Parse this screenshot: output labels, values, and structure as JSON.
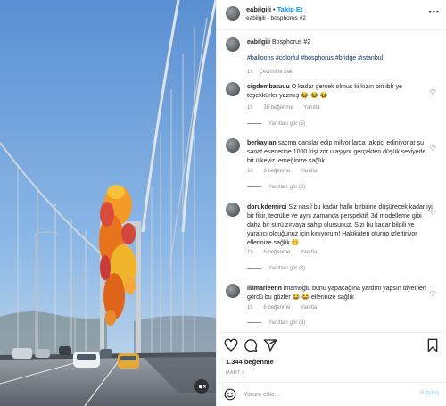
{
  "header": {
    "username": "eabilgili",
    "separator": "•",
    "follow_label": "Takip Et",
    "location": "eabilgili - bosphorus #2",
    "more_label": "•••"
  },
  "caption": {
    "username": "eabilgili",
    "text": "Bosphorus #2",
    "hashtags": "#balloons #colorful #bosphorus #bridge #istanbul",
    "time": "1h",
    "translate_label": "Çevirisine bak"
  },
  "comments": [
    {
      "username": "cigdembatuuu",
      "text": "O kadar gerçek olmuş ki kızın biri ibb ye teşekkürler yazmış 😂 😂 😂",
      "time": "1h",
      "likes": "35 beğenme",
      "reply_label": "Yanıtla",
      "replies": "Yanıtları gör (5)"
    },
    {
      "username": "berkaylan",
      "text": "saçma danslar edip milyonlarca takipçi ediniyorlar şu sanat eserlerine 1000 kişi zor ulaşıyor gerçekten düşük seviyede bir ülkeyiz. emeğinize sağlık",
      "time": "1h",
      "likes": "8 beğenme",
      "reply_label": "Yanıtla",
      "replies": "Yanıtları gör (2)"
    },
    {
      "username": "dorukdemirci",
      "text": "Siz nasıl bu kadar halkı birbirine düşürecek kadar iyi bir fikir, tecrübe ve aynı zamanda perspektif, 3d modelleme gibi daha bir sürü zırvaya sahip olursunuz. Sizi bu kadar bilgili ve yaratıcı olduğunuz için kınıyorum! Hakikaten oturup izlettiriyor ellerinize sağlık 😊",
      "time": "1h",
      "likes": "6 beğenme",
      "reply_label": "Yanıtla",
      "replies": "Yanıtları gör (3)"
    },
    {
      "username": "lilimarleenn",
      "text": "imamoğlu bunu yapacağına yardım yapsın diyenleri gördü bu gözler 😂 😂 ellerinize sağlık",
      "time": "1h",
      "likes": "6 beğenme",
      "reply_label": "Yanıtla",
      "replies": "Yanıtları gör (3)"
    }
  ],
  "icons": {
    "like": "heart-icon",
    "comment": "comment-icon",
    "share": "share-icon",
    "save": "bookmark-icon",
    "emoji": "emoji-icon",
    "volume": "volume-muted-icon"
  },
  "actions": {
    "likes_count": "1.344 beğenme",
    "date": "MART 4"
  },
  "comment_box": {
    "placeholder": "Yorum ekle...",
    "post_label": "Paylaş"
  },
  "colors": {
    "accent": "#0095f6",
    "hashtag": "#00376b",
    "muted": "#8e8e8e",
    "post_disabled": "#b2dffc"
  }
}
